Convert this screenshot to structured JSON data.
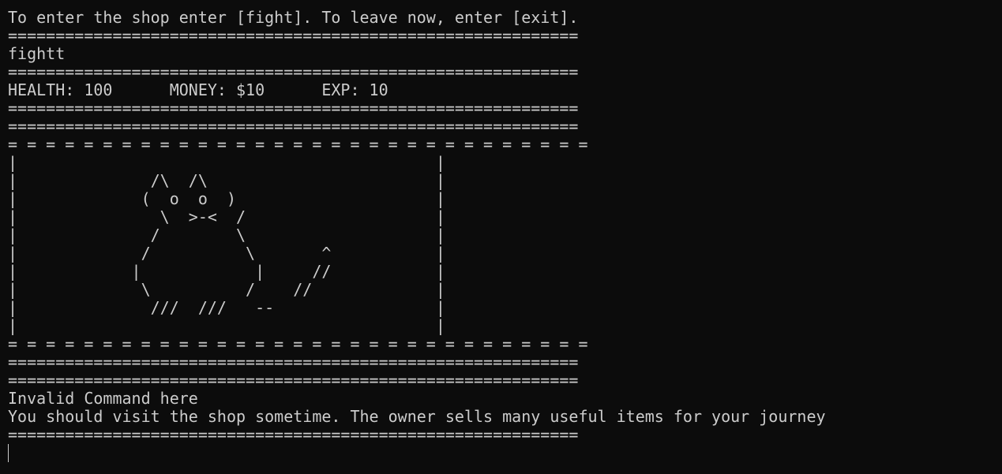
{
  "terminal": {
    "lines": [
      "To enter the shop enter [fight]. To leave now, enter [exit].",
      "============================================================",
      "fightt",
      "============================================================",
      "HEALTH: 100      MONEY: $10      EXP: 10",
      "============================================================",
      "============================================================",
      "= = = = = = = = = = = = = = = = = = = = = = = = = = = = = = =",
      "|                                            |",
      "|              /\\  /\\                        |",
      "|             (  o  o  )                     |",
      "|               \\  >-<  /                    |",
      "|              /        \\                    |",
      "|             /          \\       ^           |",
      "|            |            |     //           |",
      "|             \\          /    //             |",
      "|              ///  ///   --                 |",
      "|                                            |",
      "= = = = = = = = = = = = = = = = = = = = = = = = = = = = = = =",
      "============================================================",
      "============================================================",
      "Invalid Command here",
      "You should visit the shop sometime. The owner sells many useful items for your journey",
      "============================================================"
    ]
  },
  "colors": {
    "background": "#0c0c0c",
    "foreground": "#cccccc"
  }
}
